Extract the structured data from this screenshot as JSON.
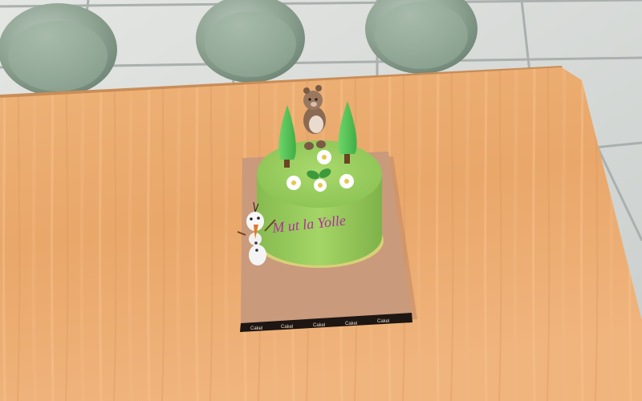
{
  "scene": {
    "cake_inscription": "M ut la Yolle",
    "board_border_text": "Cakel",
    "colors": {
      "floor": "#d9dcd9",
      "table": "#e8a86a",
      "chair": "#8fa596",
      "board": "#c99a7c",
      "cake": "#9acd5f",
      "icing_text": "#b0309a"
    }
  }
}
